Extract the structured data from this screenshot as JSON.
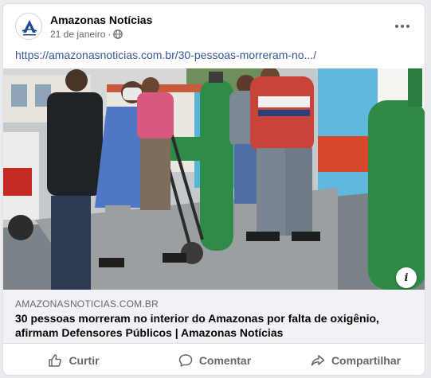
{
  "post": {
    "page_name": "Amazonas Notícias",
    "date": "21 de janeiro",
    "separator": "·",
    "privacy_icon": "globe-icon",
    "more_icon": "more-options-icon",
    "link_url": "https://amazonasnoticias.com.br/30-pessoas-morreram-no.../"
  },
  "preview": {
    "domain": "AMAZONASNOTICIAS.COM.BR",
    "title": "30 pessoas morreram no interior do Amazonas por falta de oxigênio, afirmam Defensores Públicos | Amazonas Notícias",
    "info_label": "i"
  },
  "actions": {
    "like_label": "Curtir",
    "comment_label": "Comentar",
    "share_label": "Compartilhar"
  },
  "colors": {
    "link": "#385898",
    "muted": "#65676b",
    "logo_blue": "#1d4e8f",
    "cylinder_green": "#2e8b48"
  }
}
